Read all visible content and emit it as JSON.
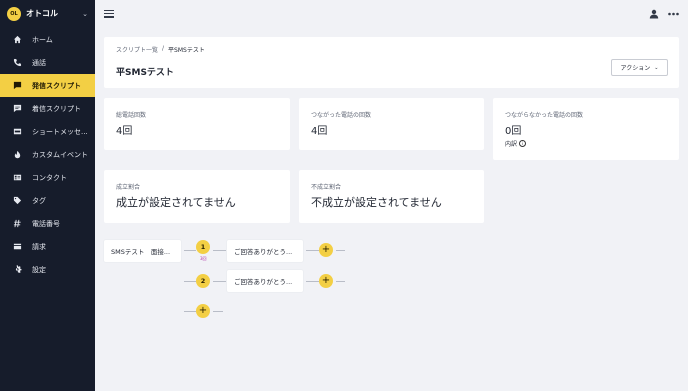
{
  "app": {
    "name": "オトコル",
    "logo_text": "OL"
  },
  "sidebar": {
    "items": [
      {
        "label": "ホーム",
        "icon": "home-icon",
        "active": false
      },
      {
        "label": "通話",
        "icon": "phone-icon",
        "active": false
      },
      {
        "label": "発信スクリプト",
        "icon": "outgoing-script-icon",
        "active": true
      },
      {
        "label": "着信スクリプト",
        "icon": "incoming-script-icon",
        "active": false
      },
      {
        "label": "ショートメッセ...",
        "icon": "sms-icon",
        "active": false
      },
      {
        "label": "カスタムイベント",
        "icon": "flame-icon",
        "active": false
      },
      {
        "label": "コンタクト",
        "icon": "contact-card-icon",
        "active": false
      },
      {
        "label": "タグ",
        "icon": "tag-icon",
        "active": false
      },
      {
        "label": "電話番号",
        "icon": "hash-icon",
        "active": false
      },
      {
        "label": "請求",
        "icon": "credit-card-icon",
        "active": false
      },
      {
        "label": "設定",
        "icon": "gear-icon",
        "active": false
      }
    ]
  },
  "breadcrumb": {
    "parent": "スクリプト一覧",
    "separator": "/",
    "current": "平SMSテスト"
  },
  "page": {
    "title": "平SMSテスト",
    "action_label": "アクション"
  },
  "stats": {
    "total_calls": {
      "label": "総電話回数",
      "value": "4回"
    },
    "connected_calls": {
      "label": "つながった電話の回数",
      "value": "4回"
    },
    "unconnected_calls": {
      "label": "つながらなかった電話の回数",
      "value": "0回",
      "breakdown": "内訳",
      "info": "i"
    },
    "success_rate": {
      "label": "成立割合",
      "value": "成立が設定されてません"
    },
    "failure_rate": {
      "label": "不成立割合",
      "value": "不成立が設定されてません"
    }
  },
  "flow": {
    "start": "SMSテスト　面接...",
    "steps": [
      {
        "number": "1",
        "tag": "3回",
        "message": "ご回答ありがとう..."
      },
      {
        "number": "2",
        "message": "ご回答ありがとう..."
      }
    ],
    "plus": "+"
  },
  "colors": {
    "sidebar_bg": "#161c2b",
    "accent": "#f3cf44",
    "page_bg": "#f1f2f6"
  }
}
